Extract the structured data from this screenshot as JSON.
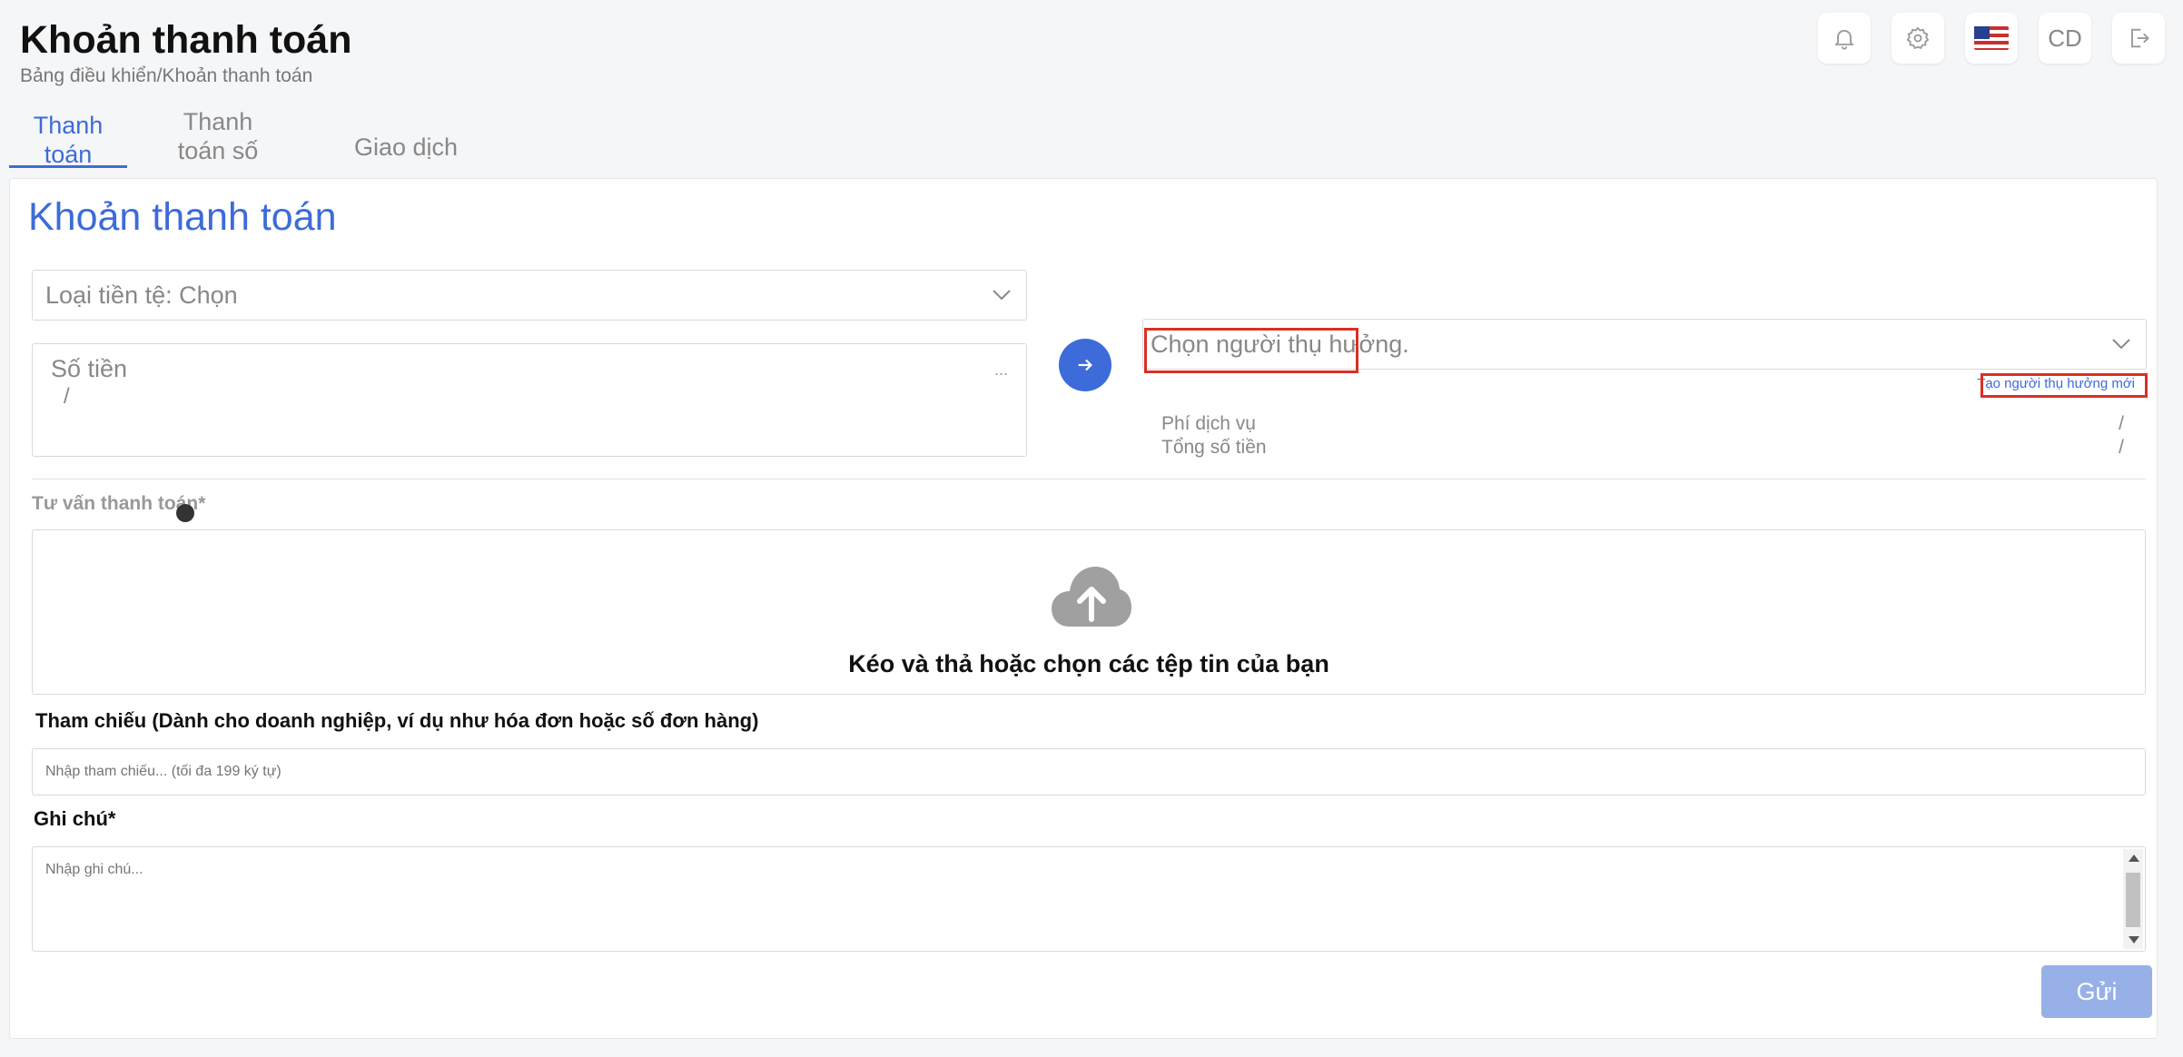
{
  "header": {
    "title": "Khoản thanh toán",
    "breadcrumb": "Bảng điều khiển/Khoản thanh toán",
    "user_initials": "CD",
    "icons": [
      "bell-icon",
      "gear-icon",
      "us-flag-icon",
      "avatar",
      "logout-icon"
    ]
  },
  "tabs": [
    {
      "label_line1": "Thanh",
      "label_line2": "toán",
      "active": true
    },
    {
      "label_line1": "Thanh",
      "label_line2": "toán số",
      "active": false
    },
    {
      "label_line1": "Giao dịch",
      "label_line2": "",
      "active": false
    }
  ],
  "form": {
    "title": "Khoản thanh toán",
    "currency_select": "Loại tiền tệ: Chọn",
    "amount_label": "Số tiền",
    "amount_value": "/",
    "amount_suffix": "...",
    "payee_select": "Chọn người thụ hưởng.",
    "new_payee_link": "Tạo người thụ hưởng mới",
    "service_fee_label": "Phí dịch vụ",
    "service_fee_value": "/",
    "total_label": "Tổng số tiền",
    "total_value": "/",
    "advice_label": "Tư vấn thanh toán*",
    "dropzone_text": "Kéo và thả hoặc chọn các tệp tin của bạn",
    "reference_label": "Tham chiếu (Dành cho doanh nghiệp, ví dụ như hóa đơn hoặc số đơn hàng)",
    "reference_placeholder": "Nhập tham chiếu... (tối đa 199 ký tự)",
    "note_label": "Ghi chú*",
    "note_placeholder": "Nhập ghi chú...",
    "submit_label": "Gửi"
  },
  "colors": {
    "accent": "#3d6bd9",
    "highlight": "#d93025",
    "submit_disabled": "#97b0e8"
  }
}
